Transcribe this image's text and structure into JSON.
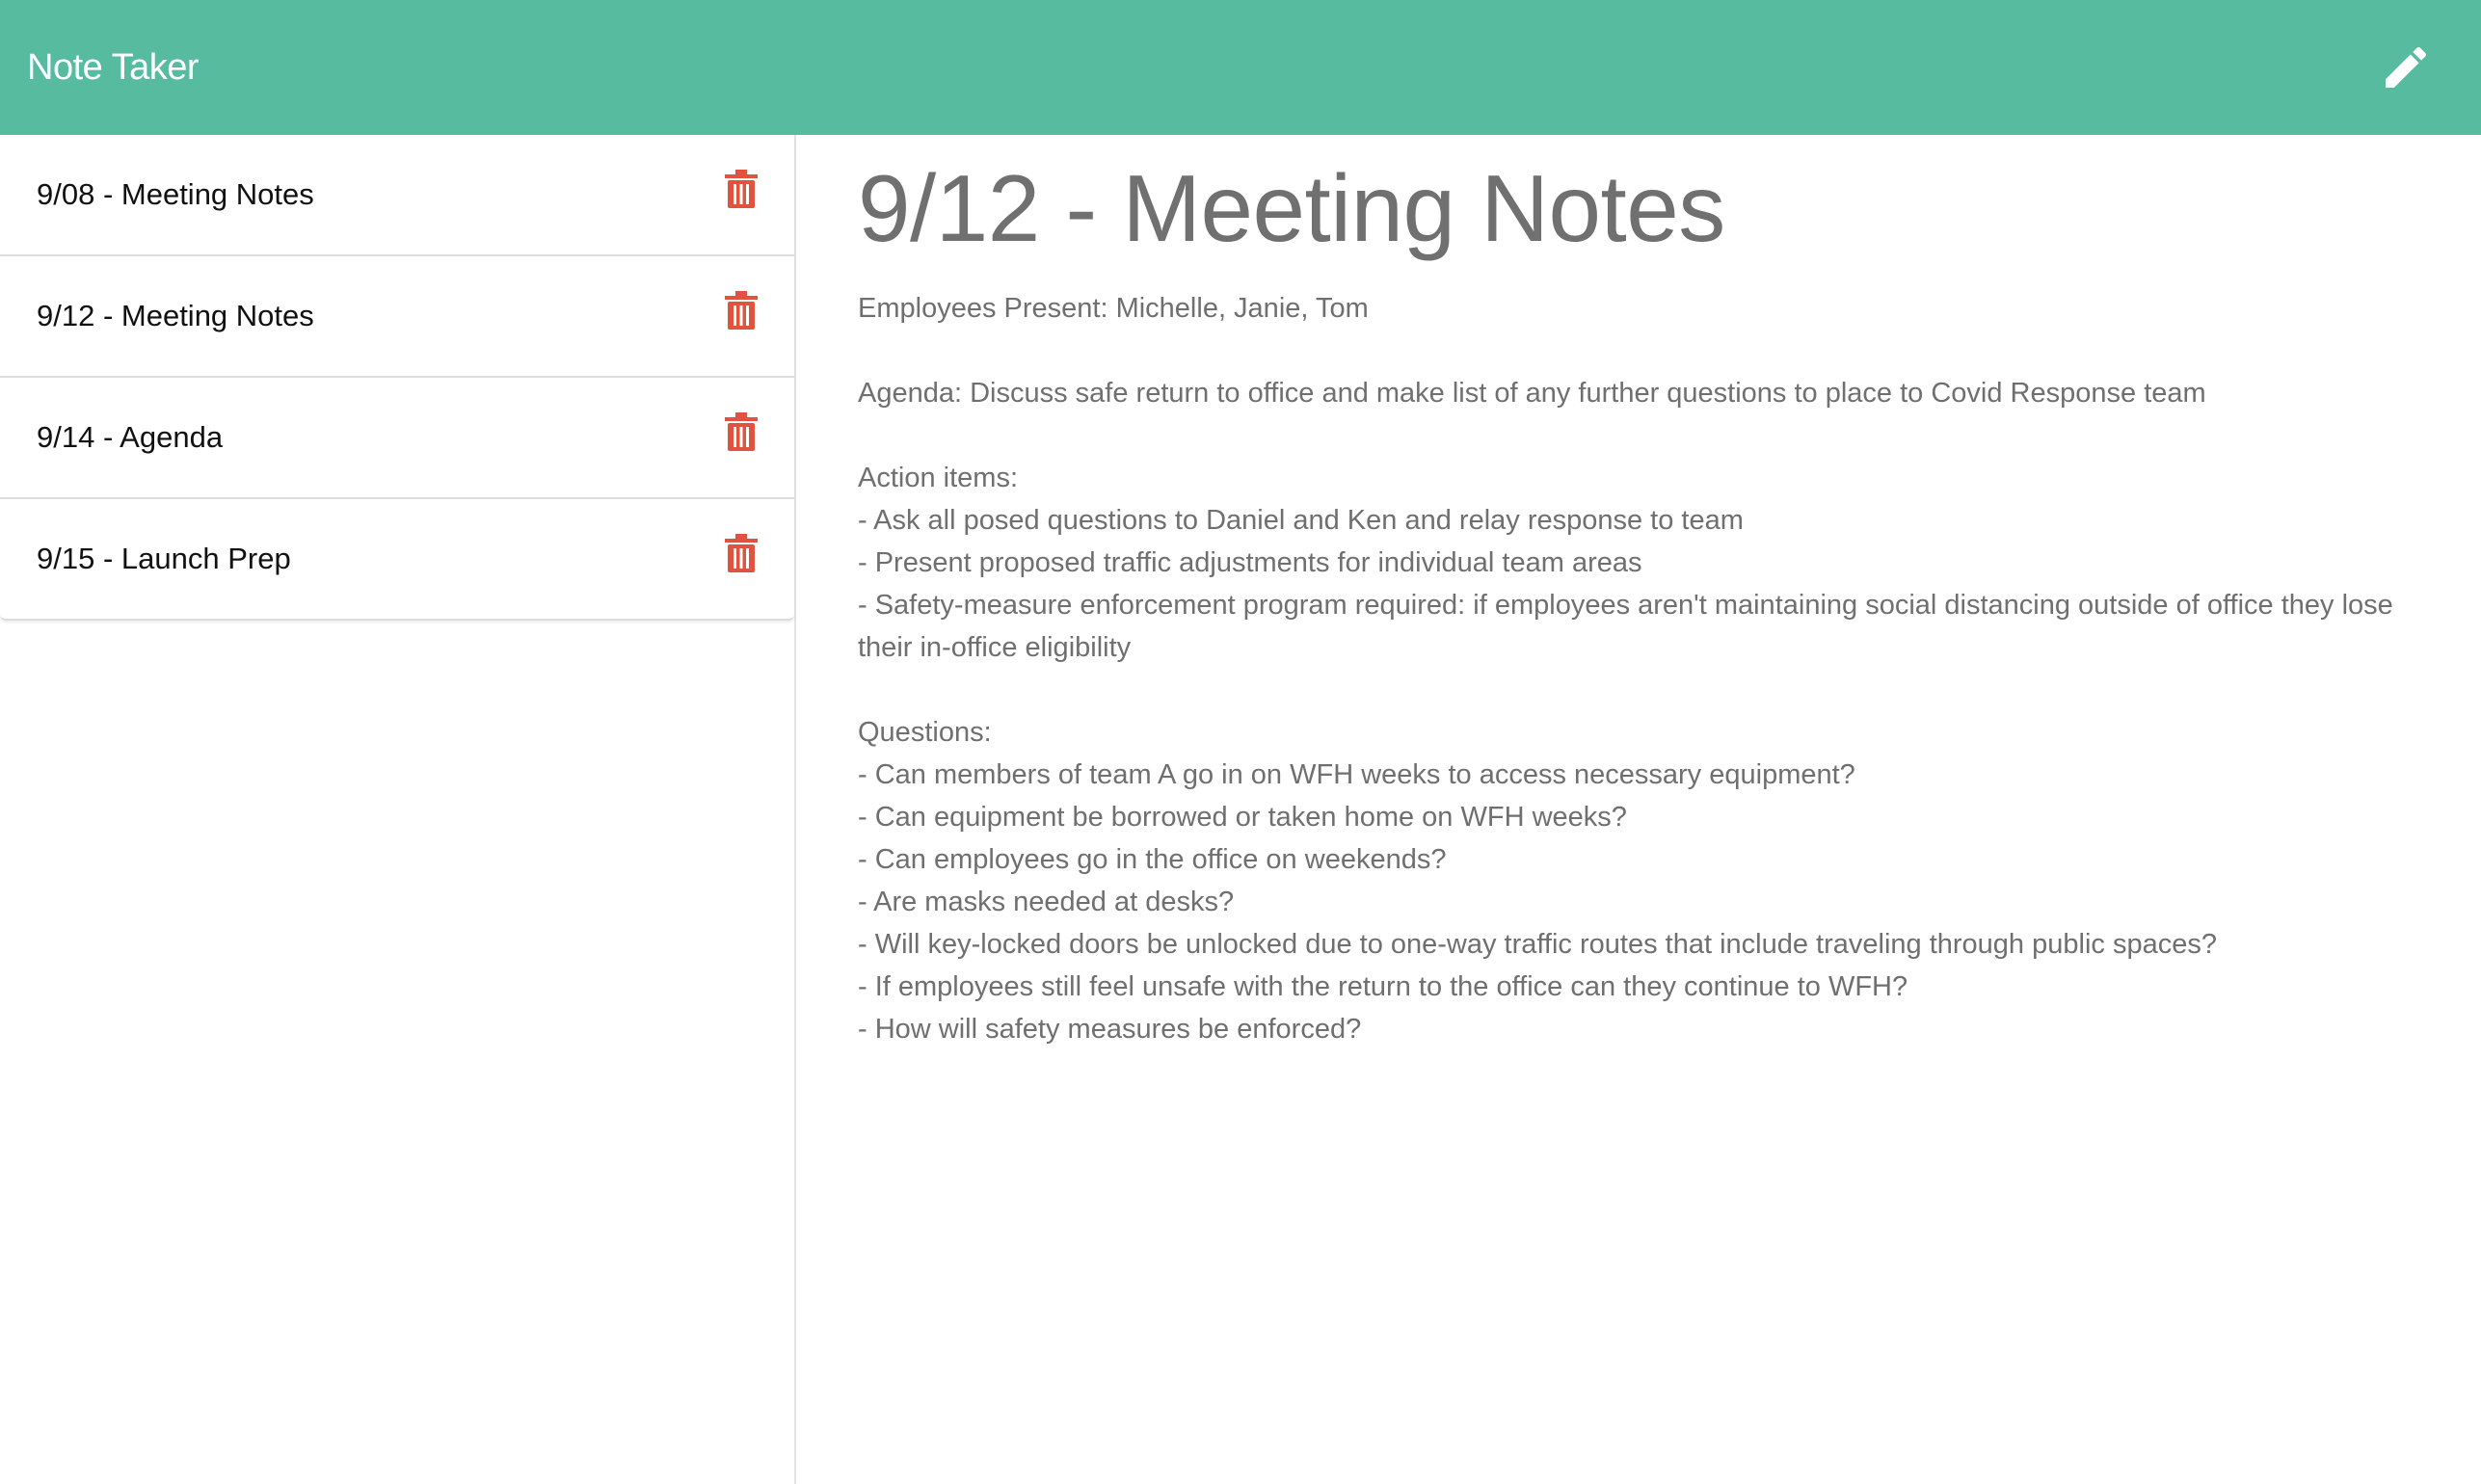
{
  "app": {
    "title": "Note Taker"
  },
  "toolbar": {
    "new_note_icon": "pencil-icon"
  },
  "colors": {
    "navbar": "#57bc9f",
    "delete_icon": "#e0533f",
    "title_text": "#707070",
    "body_text": "#6f6f6f"
  },
  "sidebar": {
    "notes": [
      {
        "title": "9/08 - Meeting Notes",
        "icon": "trash-icon"
      },
      {
        "title": "9/12 - Meeting Notes",
        "icon": "trash-icon"
      },
      {
        "title": "9/14 - Agenda",
        "icon": "trash-icon"
      },
      {
        "title": "9/15 - Launch Prep",
        "icon": "trash-icon"
      }
    ]
  },
  "active_note": {
    "title": "9/12 - Meeting Notes",
    "text": "Employees Present: Michelle, Janie, Tom\n\nAgenda: Discuss safe return to office and make list of any further questions to place to Covid Response team\n\nAction items:\n- Ask all posed questions to Daniel and Ken and relay response to team\n- Present proposed traffic adjustments for individual team areas\n- Safety-measure enforcement program required: if employees aren't maintaining social distancing outside of office they lose their in-office eligibility\n\nQuestions:\n- Can members of team A go in on WFH weeks to access necessary equipment?\n- Can equipment be borrowed or taken home on WFH weeks?\n- Can employees go in the office on weekends?\n- Are masks needed at desks?\n- Will key-locked doors be unlocked due to one-way traffic routes that include traveling through public spaces?\n- If employees still feel unsafe with the return to the office can they continue to WFH?\n- How will safety measures be enforced?"
  }
}
